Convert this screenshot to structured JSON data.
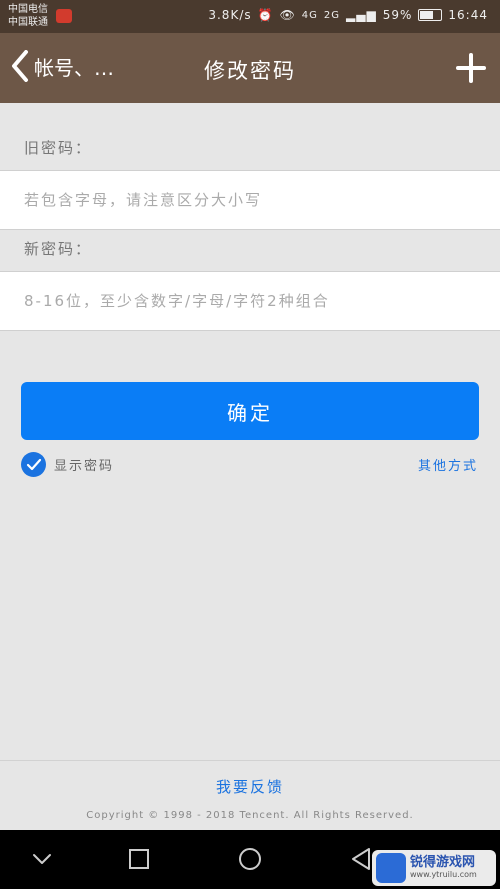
{
  "status_bar": {
    "carrier_1": "中国电信",
    "carrier_2": "中国联通",
    "net_speed": "3.8K/s",
    "signal_1": "4G",
    "signal_2": "2G",
    "battery": "59%",
    "time": "16:44"
  },
  "header": {
    "back_label": "帐号、…",
    "title": "修改密码"
  },
  "form": {
    "old_label": "旧密码：",
    "old_placeholder": "若包含字母，请注意区分大小写",
    "new_label": "新密码：",
    "new_placeholder": "8-16位，至少含数字/字母/字符2种组合",
    "confirm_label": "确定",
    "show_password_label": "显示密码",
    "show_password_checked": true,
    "other_methods_label": "其他方式"
  },
  "footer": {
    "feedback_label": "我要反馈",
    "copyright": "Copyright © 1998 - 2018 Tencent. All Rights Reserved."
  },
  "watermark": {
    "name": "锐得游戏网",
    "url": "www.ytruilu.com"
  },
  "colors": {
    "header_bg": "#6d5747",
    "status_bg": "#4a3a2e",
    "accent": "#0a7df6",
    "link": "#1b73e0",
    "page_bg": "#e6e6e6"
  }
}
